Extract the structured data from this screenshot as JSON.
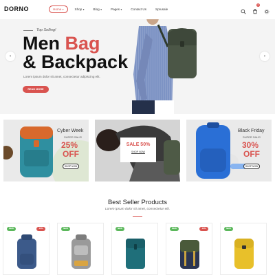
{
  "brand": "DORNO",
  "nav": [
    {
      "label": "Home",
      "active": true
    },
    {
      "label": "Shop",
      "active": false
    },
    {
      "label": "Blog",
      "active": false
    },
    {
      "label": "Pages",
      "active": false
    },
    {
      "label": "Contact Us",
      "active": false
    },
    {
      "label": "Sprusale",
      "active": false
    }
  ],
  "header_icons": [
    "search-icon",
    "cart-icon",
    "gear-icon"
  ],
  "cart_count": "0",
  "hero": {
    "tag": "Top Selling!",
    "title_line1_a": "Men ",
    "title_line1_b": "Bag",
    "title_line2": "& Backpack",
    "subtitle": "Lorem ipsum dolor sit amet, consectetur adipiscing elit.",
    "button": "READ MORE",
    "prev": "‹",
    "next": "›"
  },
  "promos": [
    {
      "title": "Cyber Week",
      "super": "SUPER SALE!",
      "percent": "25%",
      "off": "OFF",
      "button": "SHOP NOW"
    },
    {
      "title": "SALE 50%",
      "button": "SHOP NOW"
    },
    {
      "title": "Black Friday",
      "super": "SUPER SALE!",
      "percent": "30%",
      "off": "OFF",
      "button": "SHOP NOW"
    }
  ],
  "best_seller": {
    "title": "Best Seller Products",
    "subtitle": "Lorem ipsum dolor sit amet, consectetur elit."
  },
  "products": [
    {
      "new_tag": "NEW",
      "off_tag": "10%",
      "color": "#3c5a8a"
    },
    {
      "new_tag": "NEW",
      "off_tag": "",
      "color": "#9a9a9a"
    },
    {
      "new_tag": "NEW",
      "off_tag": "",
      "color": "#1f6f7a"
    },
    {
      "new_tag": "NEW",
      "off_tag": "10%",
      "color": "#4a5a3a"
    },
    {
      "new_tag": "NEW",
      "off_tag": "",
      "color": "#e8c02a"
    }
  ],
  "colors": {
    "accent": "#d9534f",
    "new": "#5cb85c"
  }
}
